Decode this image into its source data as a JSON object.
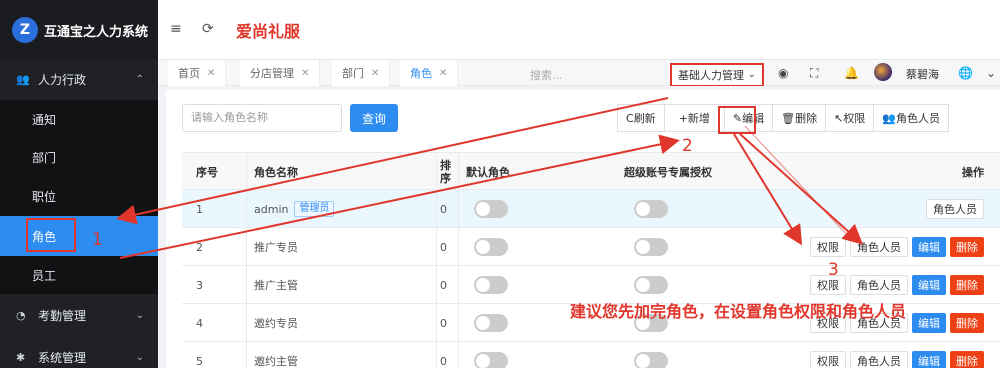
{
  "app": {
    "title": "互通宝之人力系统",
    "logo_letter": "Z"
  },
  "sidebar": {
    "groups": [
      {
        "label": "人力行政",
        "icon": "users-icon",
        "expanded": true
      },
      {
        "label": "考勤管理",
        "icon": "clock-icon",
        "expanded": false
      },
      {
        "label": "系统管理",
        "icon": "gear-icon",
        "expanded": false
      }
    ],
    "items": [
      "通知",
      "部门",
      "职位",
      "角色",
      "员工"
    ],
    "active_item": "角色"
  },
  "header": {
    "company": "爱尚礼服",
    "menu_icon": "≡",
    "refresh_icon": "⟳"
  },
  "tabs": [
    {
      "label": "首页"
    },
    {
      "label": "分店管理"
    },
    {
      "label": "部门"
    },
    {
      "label": "角色",
      "active": true
    }
  ],
  "toolbar": {
    "search_placeholder": "搜索...",
    "department_select": "基础人力管理",
    "user_name": "蔡碧海"
  },
  "role_search": {
    "placeholder": "请输入角色名称",
    "query_label": "查询"
  },
  "actions": [
    "刷新",
    "新增",
    "编辑",
    "删除",
    "权限",
    "角色人员"
  ],
  "action_icons": [
    "C",
    "+",
    "✎",
    "🗑",
    "↖",
    "👥"
  ],
  "table": {
    "headers": {
      "index": "序号",
      "name": "角色名称",
      "sort": "排序",
      "default_role": "默认角色",
      "super_auth": "超级账号专属授权",
      "ops": "操作"
    },
    "rows": [
      {
        "index": "1",
        "name": "admin",
        "tag": "管理员",
        "sort": "0"
      },
      {
        "index": "2",
        "name": "推广专员",
        "sort": "0"
      },
      {
        "index": "3",
        "name": "推广主管",
        "sort": "0"
      },
      {
        "index": "4",
        "name": "邀约专员",
        "sort": "0"
      },
      {
        "index": "5",
        "name": "邀约主管",
        "sort": "0"
      }
    ],
    "row_ops": {
      "permission": "权限",
      "members": "角色人员",
      "edit": "编辑",
      "delete": "删除"
    }
  },
  "annotations": {
    "marks": [
      "1",
      "2",
      "3"
    ],
    "note": "建议您先加完角色，在设置角色权限和角色人员",
    "color": "#e0362c"
  },
  "colors": {
    "primary": "#2d8cf0",
    "danger": "#ed4014",
    "sidebar": "#1f2125"
  }
}
